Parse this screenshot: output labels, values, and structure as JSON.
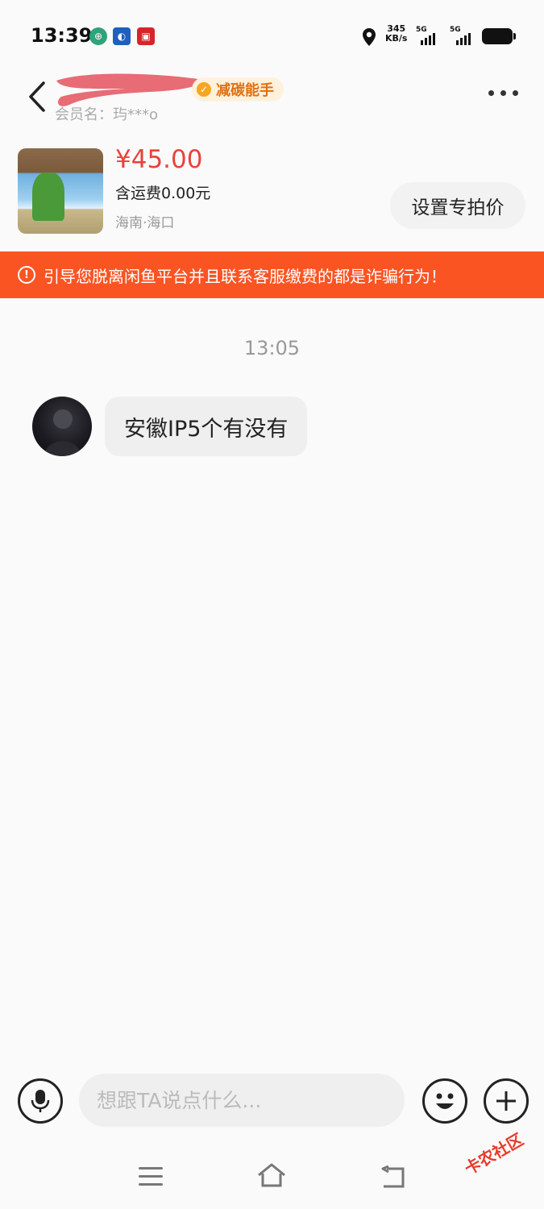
{
  "status_bar": {
    "time": "13:39",
    "net_speed_value": "345",
    "net_speed_unit": "KB/s",
    "sim1_label": "5G",
    "sim2_label": "5G"
  },
  "header": {
    "member_label": "会员名：玙***o",
    "badge_label": "减碳能手"
  },
  "product": {
    "price": "¥45.00",
    "shipping": "含运费0.00元",
    "location": "海南·海口",
    "set_price_button": "设置专拍价"
  },
  "warning_banner": {
    "text": "引导您脱离闲鱼平台并且联系客服缴费的都是诈骗行为！"
  },
  "chat": {
    "timestamp": "13:05",
    "messages": [
      {
        "sender": "other",
        "text": "安徽IP5个有没有"
      }
    ]
  },
  "composer": {
    "placeholder": "想跟TA说点什么..."
  },
  "watermark": "卡农社区",
  "colors": {
    "price_red": "#e8433a",
    "warning_orange": "#fb5423",
    "badge_orange": "#e0700f"
  }
}
